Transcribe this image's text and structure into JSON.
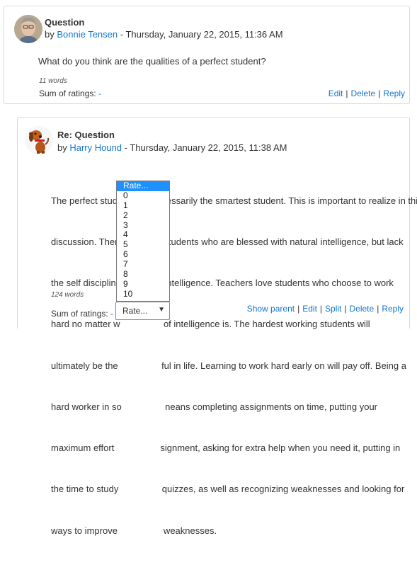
{
  "posts": [
    {
      "subject": "Question",
      "by_prefix": "by ",
      "author": "Bonnie Tensen",
      "date": " - Thursday, January 22, 2015, 11:36 AM",
      "content": "What do you think are the qualities of a perfect student?",
      "word_count": "11 words",
      "sum_label": "Sum of ratings: ",
      "sum_value": "-",
      "commands": [
        "Edit",
        "Delete",
        "Reply"
      ],
      "separator": "|"
    },
    {
      "subject": "Re: Question",
      "by_prefix": "by ",
      "author": "Harry Hound",
      "date": " - Thursday, January 22, 2015, 11:38 AM",
      "content_lines": [
        "The perfect student isn't necessarily the smartest student. This is important to realize in this",
        "discussion. There                students who are blessed with natural intelligence, but lack",
        "the self discipline                 intelligence. Teachers love students who choose to work",
        "hard no matter w                 of intelligence is. The hardest working students will",
        "ultimately be the                 ful in life. Learning to work hard early on will pay off. Being a",
        "hard worker in so                 neans completing assignments on time, putting your",
        "maximum effort                  signment, asking for extra help when you need it, putting in",
        "the time to study                 quizzes, as well as recognizing weaknesses and looking for",
        "ways to improve                  weaknesses."
      ],
      "word_count": "124 words",
      "sum_label": "Sum of ratings: ",
      "sum_value": "-",
      "commands": [
        "Show parent",
        "Edit",
        "Split",
        "Delete",
        "Reply"
      ],
      "separator": "|"
    }
  ],
  "rating_select": {
    "selected": "Rate...",
    "arrow": "▼",
    "options": [
      "Rate...",
      "0",
      "1",
      "2",
      "3",
      "4",
      "5",
      "6",
      "7",
      "8",
      "9",
      "10"
    ]
  }
}
